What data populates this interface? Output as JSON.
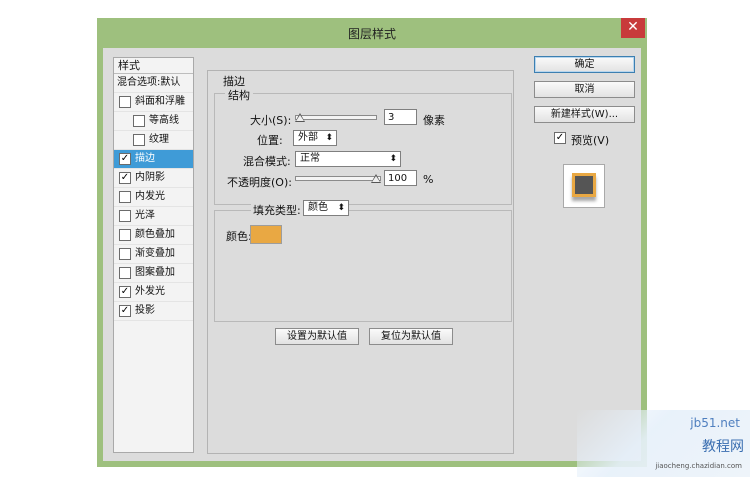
{
  "window": {
    "title": "图层样式",
    "close_glyph": "✕"
  },
  "styles_panel": {
    "header": "样式",
    "items": [
      {
        "label": "混合选项:默认",
        "checkbox": false,
        "checked": false,
        "sub": false,
        "selected": false
      },
      {
        "label": "斜面和浮雕",
        "checkbox": true,
        "checked": false,
        "sub": false,
        "selected": false
      },
      {
        "label": "等高线",
        "checkbox": true,
        "checked": false,
        "sub": true,
        "selected": false
      },
      {
        "label": "纹理",
        "checkbox": true,
        "checked": false,
        "sub": true,
        "selected": false
      },
      {
        "label": "描边",
        "checkbox": true,
        "checked": true,
        "sub": false,
        "selected": true
      },
      {
        "label": "内阴影",
        "checkbox": true,
        "checked": true,
        "sub": false,
        "selected": false
      },
      {
        "label": "内发光",
        "checkbox": true,
        "checked": false,
        "sub": false,
        "selected": false
      },
      {
        "label": "光泽",
        "checkbox": true,
        "checked": false,
        "sub": false,
        "selected": false
      },
      {
        "label": "颜色叠加",
        "checkbox": true,
        "checked": false,
        "sub": false,
        "selected": false
      },
      {
        "label": "渐变叠加",
        "checkbox": true,
        "checked": false,
        "sub": false,
        "selected": false
      },
      {
        "label": "图案叠加",
        "checkbox": true,
        "checked": false,
        "sub": false,
        "selected": false
      },
      {
        "label": "外发光",
        "checkbox": true,
        "checked": true,
        "sub": false,
        "selected": false
      },
      {
        "label": "投影",
        "checkbox": true,
        "checked": true,
        "sub": false,
        "selected": false
      }
    ]
  },
  "stroke": {
    "section_title": "描边",
    "structure_title": "结构",
    "size_label": "大小(S):",
    "size_value": "3",
    "size_unit": "像素",
    "position_label": "位置:",
    "position_value": "外部",
    "blend_label": "混合模式:",
    "blend_value": "正常",
    "opacity_label": "不透明度(O):",
    "opacity_value": "100",
    "opacity_unit": "%",
    "fill_type_label": "填充类型:",
    "fill_type_value": "颜色",
    "color_label": "颜色:",
    "color_hex": "#e9a843",
    "set_default_button": "设置为默认值",
    "reset_default_button": "复位为默认值"
  },
  "actions": {
    "ok_button": "确定",
    "cancel_button": "取消",
    "new_style_button": "新建样式(W)...",
    "preview_label": "预览(V)",
    "preview_checked": true
  },
  "watermark": {
    "top": "jb51.net",
    "main": "教程网",
    "sub": "jiaocheng.chazidian.com"
  },
  "icons": {
    "checkmark": "✓",
    "dropdown_arrow": "⬍"
  }
}
